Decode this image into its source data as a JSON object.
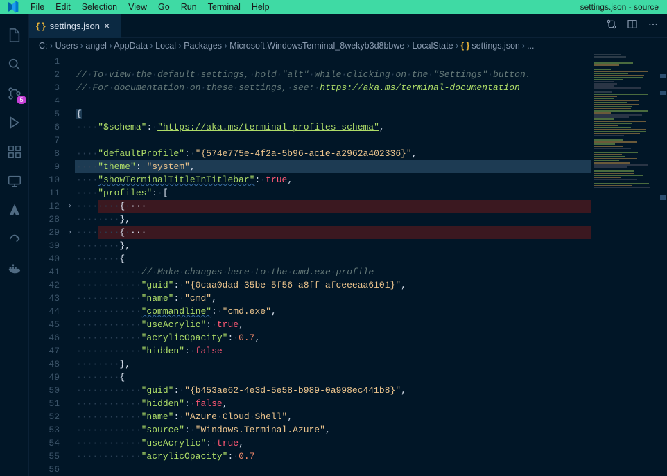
{
  "menubar": {
    "items": [
      "File",
      "Edit",
      "Selection",
      "View",
      "Go",
      "Run",
      "Terminal",
      "Help"
    ],
    "windowTitle": "settings.json - source"
  },
  "activitybar": {
    "scmBadge": "5"
  },
  "tab": {
    "iconGlyph": "{ }",
    "label": "settings.json",
    "close": "×"
  },
  "breadcrumbs": {
    "parts": [
      "C:",
      "Users",
      "angel",
      "AppData",
      "Local",
      "Packages",
      "Microsoft.WindowsTerminal_8wekyb3d8bbwe",
      "LocalState"
    ],
    "fileIcon": "{ }",
    "file": "settings.json",
    "tail": "..."
  },
  "gutter": {
    "numbers": [
      "1",
      "2",
      "3",
      "4",
      "5",
      "6",
      "7",
      "8",
      "9",
      "10",
      "11",
      "12",
      "28",
      "29",
      "39",
      "40",
      "41",
      "42",
      "43",
      "44",
      "45",
      "46",
      "47",
      "48",
      "49",
      "50",
      "51",
      "52",
      "53",
      "54",
      "55",
      "56"
    ]
  },
  "fold": {
    "glyph": "›",
    "rows": [
      11,
      13
    ]
  },
  "code": {
    "l2a": "// To view the default settings, hold \"alt\" while clicking on the \"Settings\" button.",
    "l3a": "// For documentation on these settings, see: ",
    "l3b": "https://aka.ms/terminal-documentation",
    "l5": "{",
    "l6k": "\"$schema\"",
    "l6s": "\"https://aka.ms/terminal-profiles-schema\"",
    "l8k": "\"defaultProfile\"",
    "l8s": "\"{574e775e-4f2a-5b96-ac1e-a2962a402336}\"",
    "l9k": "\"theme\"",
    "l9s": "\"system\"",
    "l10k": "\"showTerminalTitleInTitlebar\"",
    "l10v": "true",
    "l11k": "\"profiles\"",
    "l11v": "[",
    "fold": "{ ···",
    "closeBrace": "},",
    "openBrace": "{",
    "l41": "// Make changes here to the cmd.exe profile",
    "l42k": "\"guid\"",
    "l42s": "\"{0caa0dad-35be-5f56-a8ff-afceeeaa6101}\"",
    "l43k": "\"name\"",
    "l43s": "\"cmd\"",
    "l44k": "\"commandline\"",
    "l44s": "\"cmd.exe\"",
    "l45k": "\"useAcrylic\"",
    "l45v": "true",
    "l46k": "\"acrylicOpacity\"",
    "l46v": "0.7",
    "l47k": "\"hidden\"",
    "l47v": "false",
    "l50k": "\"guid\"",
    "l50s": "\"{b453ae62-4e3d-5e58-b989-0a998ec441b8}\"",
    "l51k": "\"hidden\"",
    "l51v": "false",
    "l52k": "\"name\"",
    "l52s": "\"Azure Cloud Shell\"",
    "l53k": "\"source\"",
    "l53s": "\"Windows.Terminal.Azure\"",
    "l54k": "\"useAcrylic\"",
    "l54v": "true",
    "l55k": "\"acrylicOpacity\"",
    "l55v": "0.7"
  }
}
